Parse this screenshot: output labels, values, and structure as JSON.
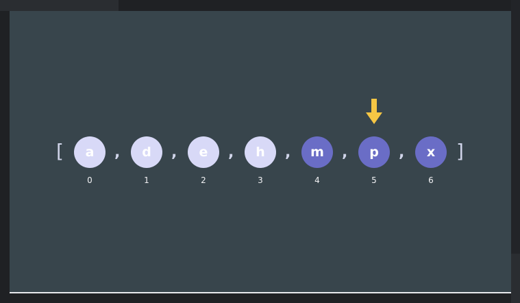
{
  "diagram": {
    "open_bracket": "[",
    "close_bracket": "]",
    "separator": ",",
    "pointer_index": 5,
    "colors": {
      "panel": "#38454c",
      "node_light": "#d8d9f7",
      "node_dark": "#6a6dc6",
      "pointer": "#f6c644"
    },
    "elements": [
      {
        "value": "a",
        "index": "0",
        "state": "light"
      },
      {
        "value": "d",
        "index": "1",
        "state": "light"
      },
      {
        "value": "e",
        "index": "2",
        "state": "light"
      },
      {
        "value": "h",
        "index": "3",
        "state": "light"
      },
      {
        "value": "m",
        "index": "4",
        "state": "dark"
      },
      {
        "value": "p",
        "index": "5",
        "state": "dark"
      },
      {
        "value": "x",
        "index": "6",
        "state": "dark"
      }
    ]
  }
}
